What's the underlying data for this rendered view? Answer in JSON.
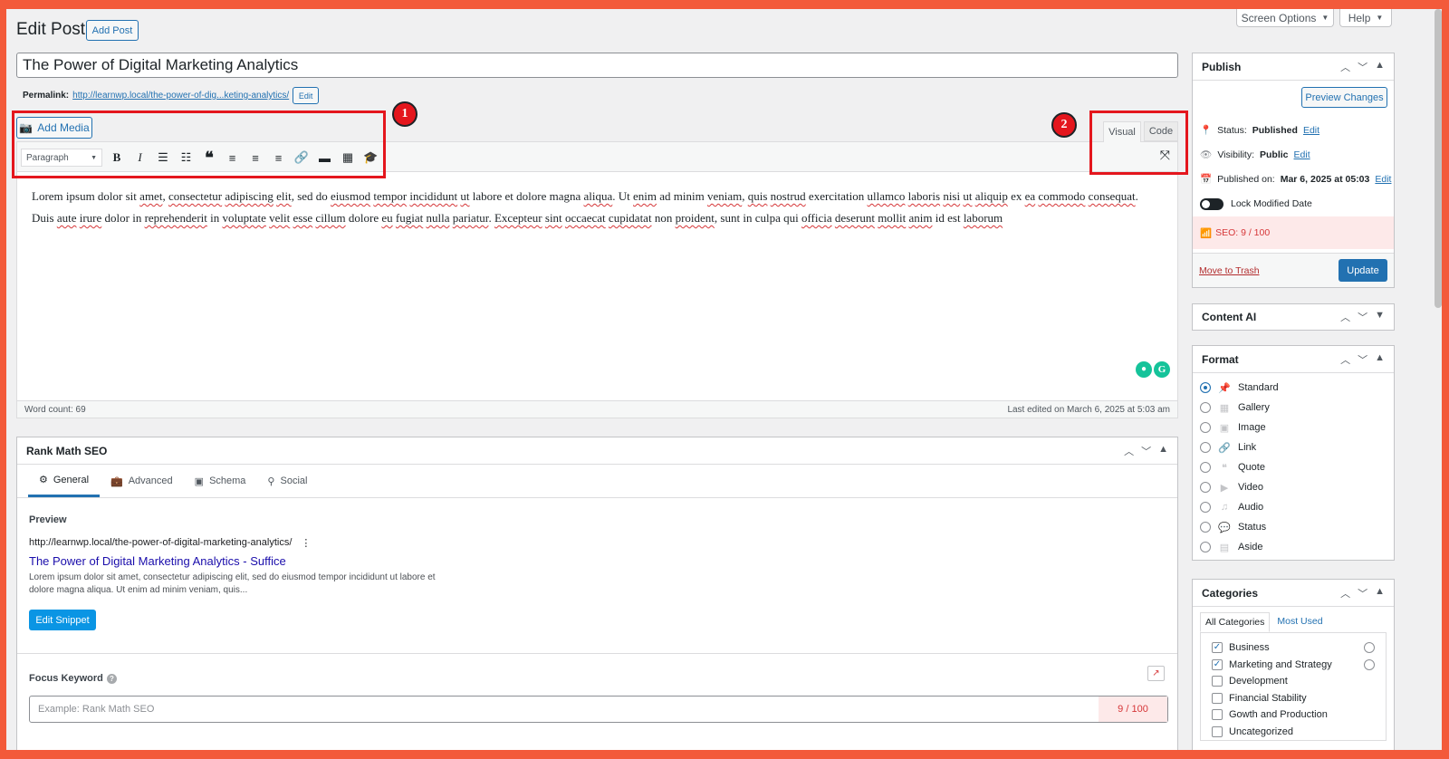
{
  "header": {
    "page_title": "Edit Post",
    "add_post": "Add Post",
    "screen_options": "Screen Options",
    "help": "Help"
  },
  "post": {
    "title": "The Power of Digital Marketing Analytics",
    "permalink_label": "Permalink:",
    "permalink_url": "http://learnwp.local/the-power-of-dig...keting-analytics/",
    "permalink_edit": "Edit"
  },
  "editor": {
    "add_media": "Add Media",
    "format_select": "Paragraph",
    "tab_visual": "Visual",
    "tab_code": "Code",
    "paragraph_words": [
      {
        "t": "Lorem ipsum dolor sit ",
        "s": false
      },
      {
        "t": "amet",
        "s": true
      },
      {
        "t": ", ",
        "s": false
      },
      {
        "t": "consectetur",
        "s": true
      },
      {
        "t": " ",
        "s": false
      },
      {
        "t": "adipiscing",
        "s": true
      },
      {
        "t": " ",
        "s": false
      },
      {
        "t": "elit",
        "s": true
      },
      {
        "t": ", sed do ",
        "s": false
      },
      {
        "t": "eiusmod",
        "s": true
      },
      {
        "t": " ",
        "s": false
      },
      {
        "t": "tempor",
        "s": true
      },
      {
        "t": " ",
        "s": false
      },
      {
        "t": "incididunt",
        "s": true
      },
      {
        "t": " ",
        "s": false
      },
      {
        "t": "ut",
        "s": true
      },
      {
        "t": " labore et dolore magna ",
        "s": false
      },
      {
        "t": "aliqua",
        "s": true
      },
      {
        "t": ". Ut ",
        "s": false
      },
      {
        "t": "enim",
        "s": true
      },
      {
        "t": " ad minim ",
        "s": false
      },
      {
        "t": "veniam",
        "s": true
      },
      {
        "t": ", ",
        "s": false
      },
      {
        "t": "quis",
        "s": true
      },
      {
        "t": " ",
        "s": false
      },
      {
        "t": "nostrud",
        "s": true
      },
      {
        "t": " exercitation ",
        "s": false
      },
      {
        "t": "ullamco",
        "s": true
      },
      {
        "t": " ",
        "s": false
      },
      {
        "t": "laboris",
        "s": true
      },
      {
        "t": " ",
        "s": false
      },
      {
        "t": "nisi",
        "s": true
      },
      {
        "t": " ",
        "s": false
      },
      {
        "t": "ut",
        "s": true
      },
      {
        "t": " ",
        "s": false
      },
      {
        "t": "aliquip",
        "s": true
      },
      {
        "t": " ex ",
        "s": false
      },
      {
        "t": "ea",
        "s": true
      },
      {
        "t": " ",
        "s": false
      },
      {
        "t": "commodo",
        "s": true
      },
      {
        "t": " ",
        "s": false
      },
      {
        "t": "consequat",
        "s": true
      },
      {
        "t": ". Duis ",
        "s": false
      },
      {
        "t": "aute",
        "s": true
      },
      {
        "t": " ",
        "s": false
      },
      {
        "t": "irure",
        "s": true
      },
      {
        "t": " dolor in ",
        "s": false
      },
      {
        "t": "reprehenderit",
        "s": true
      },
      {
        "t": " in ",
        "s": false
      },
      {
        "t": "voluptate",
        "s": true
      },
      {
        "t": " ",
        "s": false
      },
      {
        "t": "velit",
        "s": true
      },
      {
        "t": " ",
        "s": false
      },
      {
        "t": "esse",
        "s": true
      },
      {
        "t": " ",
        "s": false
      },
      {
        "t": "cillum",
        "s": true
      },
      {
        "t": " dolore ",
        "s": false
      },
      {
        "t": "eu",
        "s": true
      },
      {
        "t": " ",
        "s": false
      },
      {
        "t": "fugiat",
        "s": true
      },
      {
        "t": " ",
        "s": false
      },
      {
        "t": "nulla",
        "s": true
      },
      {
        "t": " ",
        "s": false
      },
      {
        "t": "pariatur",
        "s": true
      },
      {
        "t": ". ",
        "s": false
      },
      {
        "t": "Excepteur",
        "s": true
      },
      {
        "t": " ",
        "s": false
      },
      {
        "t": "sint",
        "s": true
      },
      {
        "t": " ",
        "s": false
      },
      {
        "t": "occaecat",
        "s": true
      },
      {
        "t": " ",
        "s": false
      },
      {
        "t": "cupidatat",
        "s": true
      },
      {
        "t": " non ",
        "s": false
      },
      {
        "t": "proident",
        "s": true
      },
      {
        "t": ", sunt in culpa qui ",
        "s": false
      },
      {
        "t": "officia",
        "s": true
      },
      {
        "t": " ",
        "s": false
      },
      {
        "t": "deserunt",
        "s": true
      },
      {
        "t": " ",
        "s": false
      },
      {
        "t": "mollit",
        "s": true
      },
      {
        "t": " ",
        "s": false
      },
      {
        "t": "anim",
        "s": true
      },
      {
        "t": " id est ",
        "s": false
      },
      {
        "t": "laborum",
        "s": true
      }
    ],
    "word_count": "Word count: 69",
    "last_edited": "Last edited on March 6, 2025 at 5:03 am",
    "marker_1": "1",
    "marker_2": "2"
  },
  "rankmath": {
    "title": "Rank Math SEO",
    "tabs": [
      "General",
      "Advanced",
      "Schema",
      "Social"
    ],
    "preview_label": "Preview",
    "preview_url": "http://learnwp.local/the-power-of-digital-marketing-analytics/",
    "preview_title": "The Power of Digital Marketing Analytics - Suffice",
    "preview_desc_1": "Lorem ipsum dolor sit amet, consectetur adipiscing elit, sed do eiusmod tempor incididunt ut labore et",
    "preview_desc_2": "dolore magna aliqua. Ut enim ad minim veniam, quis...",
    "edit_snippet": "Edit Snippet",
    "focus_keyword_label": "Focus Keyword",
    "focus_keyword_placeholder": "Example: Rank Math SEO",
    "score": "9 / 100"
  },
  "publish": {
    "title": "Publish",
    "preview_changes": "Preview Changes",
    "status_label": "Status:",
    "status_value": "Published",
    "visibility_label": "Visibility:",
    "visibility_value": "Public",
    "published_label": "Published on:",
    "published_value": "Mar 6, 2025 at 05:03",
    "edit": "Edit",
    "lock_modified": "Lock Modified Date",
    "seo_score": "SEO: 9 / 100",
    "move_to_trash": "Move to Trash",
    "update": "Update"
  },
  "content_ai": {
    "title": "Content AI"
  },
  "format": {
    "title": "Format",
    "options": [
      "Standard",
      "Gallery",
      "Image",
      "Link",
      "Quote",
      "Video",
      "Audio",
      "Status",
      "Aside"
    ],
    "selected": "Standard"
  },
  "categories": {
    "title": "Categories",
    "tab_all": "All Categories",
    "tab_most_used": "Most Used",
    "items": [
      {
        "label": "Business",
        "checked": true
      },
      {
        "label": "Marketing and Strategy",
        "checked": true
      },
      {
        "label": "Development",
        "checked": false
      },
      {
        "label": "Financial Stability",
        "checked": false
      },
      {
        "label": "Gowth and Production",
        "checked": false
      },
      {
        "label": "Uncategorized",
        "checked": false
      }
    ]
  },
  "colors": {
    "accent": "#2271b1",
    "annotation_red": "#e4161d",
    "border_orange": "#f35a3a",
    "seo_bad": "#d63638"
  }
}
